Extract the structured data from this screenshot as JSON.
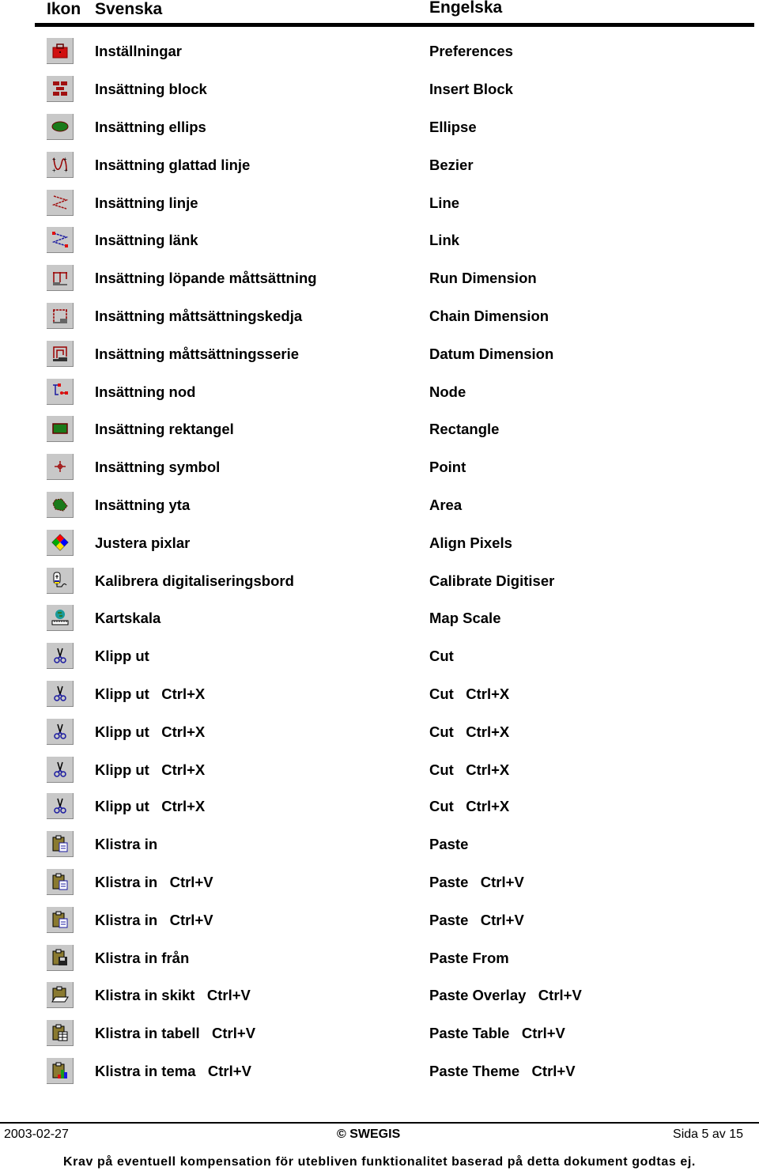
{
  "header": {
    "col_icon": "Ikon",
    "col_swedish": "Svenska",
    "col_english": "Engelska"
  },
  "rows": [
    {
      "icon": "toolbox-icon",
      "sv": "Inställningar",
      "en": "Preferences"
    },
    {
      "icon": "insert-block-icon",
      "sv": "Insättning block",
      "en": "Insert Block"
    },
    {
      "icon": "ellipse-icon",
      "sv": "Insättning ellips",
      "en": "Ellipse"
    },
    {
      "icon": "bezier-icon",
      "sv": "Insättning glattad linje",
      "en": "Bezier"
    },
    {
      "icon": "line-icon",
      "sv": "Insättning linje",
      "en": "Line"
    },
    {
      "icon": "link-icon",
      "sv": "Insättning länk",
      "en": "Link"
    },
    {
      "icon": "run-dimension-icon",
      "sv": "Insättning löpande måttsättning",
      "en": "Run Dimension"
    },
    {
      "icon": "chain-dimension-icon",
      "sv": "Insättning måttsättningskedja",
      "en": "Chain Dimension"
    },
    {
      "icon": "datum-dimension-icon",
      "sv": "Insättning måttsättningsserie",
      "en": "Datum Dimension"
    },
    {
      "icon": "node-icon",
      "sv": "Insättning nod",
      "en": "Node"
    },
    {
      "icon": "rectangle-icon",
      "sv": "Insättning rektangel",
      "en": "Rectangle"
    },
    {
      "icon": "point-icon",
      "sv": "Insättning symbol",
      "en": "Point"
    },
    {
      "icon": "area-icon",
      "sv": "Insättning yta",
      "en": "Area"
    },
    {
      "icon": "align-pixels-icon",
      "sv": "Justera pixlar",
      "en": "Align Pixels"
    },
    {
      "icon": "digitiser-icon",
      "sv": "Kalibrera digitaliseringsbord",
      "en": "Calibrate Digitiser"
    },
    {
      "icon": "map-scale-icon",
      "sv": "Kartskala",
      "en": "Map Scale"
    },
    {
      "icon": "scissors-icon",
      "sv": "Klipp ut",
      "en": "Cut"
    },
    {
      "icon": "scissors-icon",
      "sv": "Klipp ut   Ctrl+X",
      "en": "Cut   Ctrl+X"
    },
    {
      "icon": "scissors-icon",
      "sv": "Klipp ut   Ctrl+X",
      "en": "Cut   Ctrl+X"
    },
    {
      "icon": "scissors-icon",
      "sv": "Klipp ut   Ctrl+X",
      "en": "Cut   Ctrl+X"
    },
    {
      "icon": "scissors-icon",
      "sv": "Klipp ut   Ctrl+X",
      "en": "Cut   Ctrl+X"
    },
    {
      "icon": "paste-icon",
      "sv": "Klistra in",
      "en": "Paste"
    },
    {
      "icon": "paste-icon",
      "sv": "Klistra in   Ctrl+V",
      "en": "Paste   Ctrl+V"
    },
    {
      "icon": "paste-icon",
      "sv": "Klistra in   Ctrl+V",
      "en": "Paste   Ctrl+V"
    },
    {
      "icon": "paste-from-icon",
      "sv": "Klistra in från",
      "en": "Paste From"
    },
    {
      "icon": "paste-overlay-icon",
      "sv": "Klistra in skikt   Ctrl+V",
      "en": "Paste Overlay   Ctrl+V"
    },
    {
      "icon": "paste-table-icon",
      "sv": "Klistra in tabell   Ctrl+V",
      "en": "Paste Table   Ctrl+V"
    },
    {
      "icon": "paste-theme-icon",
      "sv": "Klistra in tema   Ctrl+V",
      "en": "Paste Theme   Ctrl+V"
    }
  ],
  "footer": {
    "date": "2003-02-27",
    "copyright": "© SWEGIS",
    "page": "Sida 5 av 15",
    "disclaimer": "Krav på eventuell kompensation för utebliven funktionalitet baserad på detta dokument godtas ej."
  }
}
